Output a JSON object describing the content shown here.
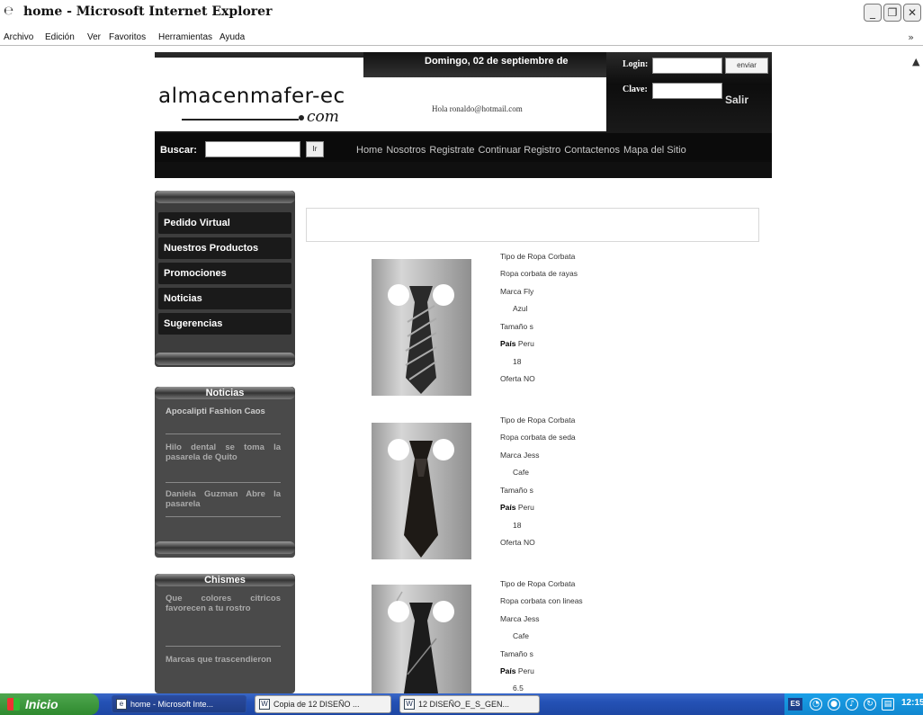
{
  "window": {
    "title": "home - Microsoft Internet Explorer",
    "controls": {
      "minimize": "_",
      "restore": "❐",
      "close": "✕"
    }
  },
  "menubar": {
    "items": [
      "Archivo",
      "Edición",
      "Ver",
      "Favoritos",
      "Herramientas",
      "Ayuda"
    ],
    "right": "»"
  },
  "header": {
    "logo": "almacenmafer-ec",
    "logo_suffix": "com",
    "date": "Domingo, 02 de septiembre de",
    "greeting": "Hola ronaldo@hotmail.com",
    "login_label": "Login:",
    "clave_label": "Clave:",
    "enviar_label": "enviar",
    "salir_label": "Salir",
    "buscar_label": "Buscar:",
    "ir_label": "Ir",
    "nav": [
      "Home",
      "Nosotros",
      "Registrate",
      "Continuar Registro",
      "Contactenos",
      "Mapa del Sitio"
    ]
  },
  "sidebar": {
    "menu": [
      "Pedido Virtual",
      "Nuestros Productos",
      "Promociones",
      "Noticias",
      "Sugerencias"
    ],
    "noticias": {
      "title": "Noticias",
      "items": [
        "Apocalipti Fashion Caos",
        "Hilo dental se toma la pasarela de Quito",
        "Daniela Guzman Abre la pasarela"
      ]
    },
    "chismes": {
      "title": "Chismes",
      "items": [
        "Que colores citricos favorecen a tu rostro",
        "Marcas que trascendieron"
      ]
    }
  },
  "products": [
    {
      "tipo": "Tipo de Ropa Corbata",
      "ropa": "Ropa corbata de rayas",
      "marca": "Marca Fly",
      "color": "Azul",
      "talla": "Tamaño s",
      "pais_label": "País",
      "pais": "Peru",
      "precio": "18",
      "oferta": "Oferta NO"
    },
    {
      "tipo": "Tipo de Ropa Corbata",
      "ropa": "Ropa corbata de seda",
      "marca": "Marca Jess",
      "color": "Cafe",
      "talla": "Tamaño s",
      "pais_label": "País",
      "pais": "Peru",
      "precio": "18",
      "oferta": "Oferta NO"
    },
    {
      "tipo": "Tipo de Ropa Corbata",
      "ropa": "Ropa corbata con lineas",
      "marca": "Marca Jess",
      "color": "Cafe",
      "talla": "Tamaño s",
      "pais_label": "País",
      "pais": "Peru",
      "precio": "6.5"
    }
  ],
  "taskbar": {
    "start": "Inicio",
    "tasks": [
      "home - Microsoft Inte...",
      "Copia de 12 DISEÑO ...",
      "12 DISEÑO_E_S_GEN..."
    ],
    "lang": "ES",
    "time": "12:15"
  },
  "colors": {
    "header_bg": "#0c0c0c",
    "sidebar_bg": "#3d3d3d",
    "taskbar": "#2451b5",
    "start_green": "#3a963a"
  }
}
